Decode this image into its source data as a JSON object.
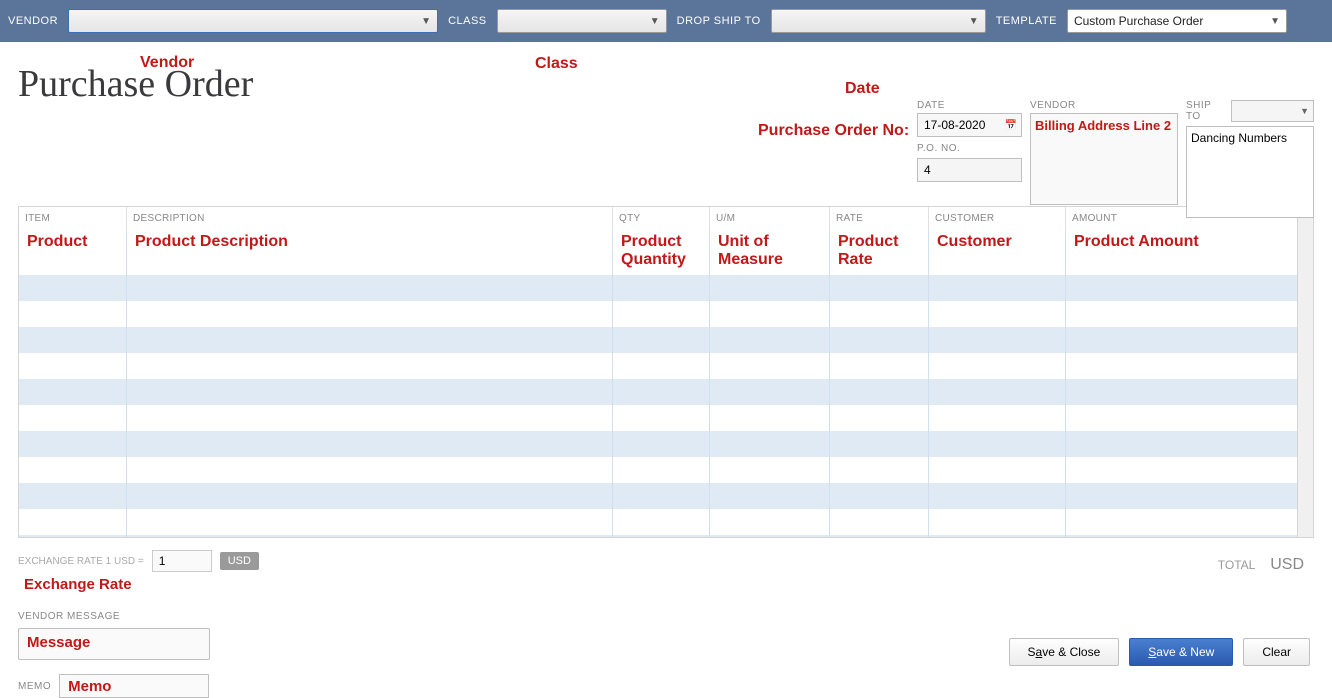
{
  "topbar": {
    "vendor_label": "VENDOR",
    "vendor_value": "",
    "class_label": "CLASS",
    "class_value": "",
    "dropship_label": "DROP SHIP TO",
    "dropship_value": "",
    "template_label": "TEMPLATE",
    "template_value": "Custom Purchase Order"
  },
  "annotations": {
    "vendor": "Vendor",
    "class": "Class",
    "date": "Date",
    "po_no": "Purchase Order No:",
    "item": "Product",
    "desc": "Product Description",
    "qty": "Product Quantity",
    "um": "Unit of Measure",
    "rate": "Product Rate",
    "customer": "Customer",
    "amount": "Product Amount",
    "exchange_rate": "Exchange Rate",
    "message": "Message",
    "memo": "Memo",
    "billing": "Billing Address Line 2"
  },
  "title": "Purchase Order",
  "header": {
    "date_label": "DATE",
    "date_value": "17-08-2020",
    "po_label": "P.O. NO.",
    "po_value": "4",
    "vendor_label": "VENDOR",
    "shipto_label": "SHIP TO",
    "shipto_value": "Dancing Numbers"
  },
  "columns": {
    "item": "ITEM",
    "description": "DESCRIPTION",
    "qty": "QTY",
    "um": "U/M",
    "rate": "RATE",
    "customer": "CUSTOMER",
    "amount": "AMOUNT"
  },
  "exchange": {
    "label": "EXCHANGE RATE 1 USD =",
    "value": "1",
    "badge": "USD"
  },
  "vendor_message_label": "VENDOR MESSAGE",
  "memo_label": "MEMO",
  "total": {
    "label": "TOTAL",
    "currency": "USD"
  },
  "buttons": {
    "save_close": "Save & Close",
    "save_new": "Save & New",
    "clear": "Clear"
  }
}
